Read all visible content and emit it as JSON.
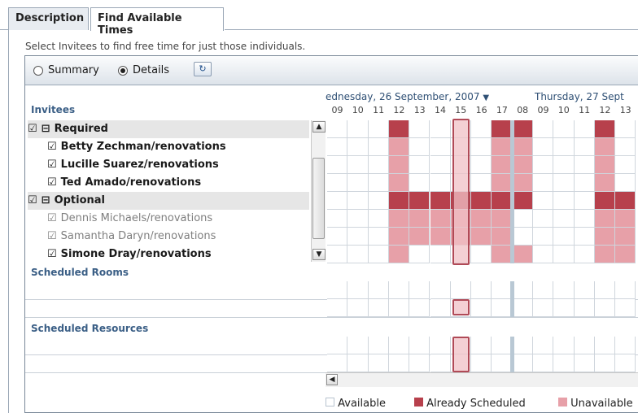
{
  "tabs": [
    {
      "label": "Description"
    },
    {
      "label": "Find Available Times"
    }
  ],
  "hint": "Select Invitees to find free time for just those individuals.",
  "toolbar": {
    "summary_label": "Summary",
    "details_label": "Details",
    "view_mode": "Details",
    "refresh_icon": "refresh-icon"
  },
  "sections": {
    "invitees": "Invitees",
    "rooms": "Scheduled Rooms",
    "resources": "Scheduled Resources"
  },
  "invitee_rows": [
    {
      "label": "Required",
      "group": true,
      "checked": true,
      "expanded": true
    },
    {
      "label": "Betty Zechman/renovations",
      "checked": true
    },
    {
      "label": "Lucille Suarez/renovations",
      "checked": true
    },
    {
      "label": "Ted Amado/renovations",
      "checked": true
    },
    {
      "label": "Optional",
      "group": true,
      "checked": true,
      "expanded": true
    },
    {
      "label": "Dennis Michaels/renovations",
      "checked": true,
      "dimmed": true
    },
    {
      "label": "Samantha Daryn/renovations",
      "checked": true,
      "dimmed": true
    },
    {
      "label": "Simone Dray/renovations",
      "checked": true
    }
  ],
  "dates": {
    "day1": "ednesday, 26 September, 2007",
    "day2": "Thursday, 27 Sept"
  },
  "hours": [
    "09",
    "10",
    "11",
    "12",
    "13",
    "14",
    "15",
    "16",
    "17",
    "08",
    "09",
    "10",
    "11",
    "12",
    "13"
  ],
  "legend": {
    "available": "Available",
    "scheduled": "Already Scheduled",
    "unavailable": "Unavailable"
  },
  "colors": {
    "available": "#ffffff",
    "scheduled": "#b7404c",
    "unavailable": "#e7a0a8",
    "selection": "#f0c0c6",
    "gap": "#b9c8d4"
  },
  "grid": {
    "rows": [
      [
        0,
        0,
        0,
        2,
        0,
        0,
        0,
        0,
        2,
        2,
        0,
        0,
        0,
        2,
        0
      ],
      [
        0,
        0,
        0,
        1,
        0,
        0,
        0,
        0,
        1,
        1,
        0,
        0,
        0,
        1,
        0
      ],
      [
        0,
        0,
        0,
        1,
        0,
        0,
        0,
        0,
        1,
        1,
        0,
        0,
        0,
        1,
        0
      ],
      [
        0,
        0,
        0,
        1,
        0,
        0,
        0,
        0,
        1,
        1,
        0,
        0,
        0,
        1,
        0
      ],
      [
        0,
        0,
        0,
        2,
        2,
        2,
        2,
        2,
        2,
        2,
        0,
        0,
        0,
        2,
        2
      ],
      [
        0,
        0,
        0,
        1,
        1,
        1,
        1,
        1,
        1,
        0,
        0,
        0,
        0,
        1,
        1
      ],
      [
        0,
        0,
        0,
        1,
        1,
        1,
        1,
        1,
        1,
        0,
        0,
        0,
        0,
        1,
        1
      ],
      [
        0,
        0,
        0,
        1,
        0,
        0,
        0,
        0,
        1,
        1,
        0,
        0,
        0,
        1,
        1
      ]
    ],
    "selected_hour_index": 6
  }
}
